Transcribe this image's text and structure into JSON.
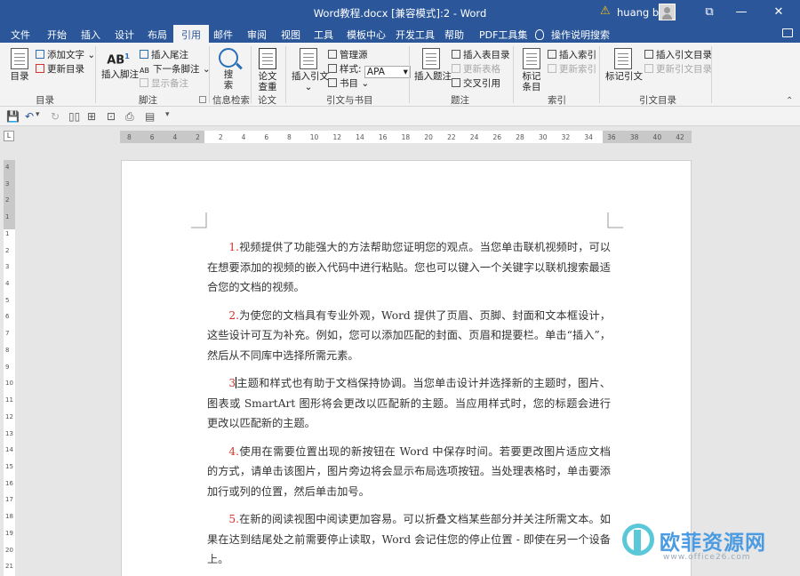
{
  "titlebar": {
    "doc_title": "Word教程.docx [兼容模式]:2  -  Word",
    "warning_icon": "warning-icon",
    "user_name": "huang bo",
    "restore_icon": "ribbon-display-icon",
    "minimize": "—",
    "maximize": "☐",
    "close": "✕"
  },
  "tabs": [
    "文件",
    "开始",
    "插入",
    "设计",
    "布局",
    "引用",
    "邮件",
    "审阅",
    "视图",
    "工具",
    "模板中心",
    "开发工具",
    "帮助",
    "PDF工具集"
  ],
  "active_tab": "引用",
  "tell_me": "操作说明搜索",
  "ribbon": {
    "groups": {
      "toc": {
        "label": "目录",
        "toc_button": "目录",
        "add_text": "添加文字",
        "update_toc": "更新目录"
      },
      "footnotes": {
        "label": "脚注",
        "insert_footnote": "插入脚注",
        "insert_endnote": "插入尾注",
        "next_footnote": "下一条脚注",
        "show_notes": "显示备注"
      },
      "research": {
        "label": "信息检索",
        "search": "搜索"
      },
      "paper": {
        "label": "论文",
        "paper_check": "论文查重"
      },
      "citations": {
        "label": "引文与书目",
        "insert_citation": "插入引文",
        "manage_sources": "管理源",
        "style_label": "样式:",
        "style_value": "APA",
        "bibliography": "书目"
      },
      "captions": {
        "label": "题注",
        "insert_caption": "插入题注",
        "insert_table_of_figures": "插入表目录",
        "update_table": "更新表格",
        "cross_reference": "交叉引用"
      },
      "index": {
        "label": "索引",
        "mark_entry": "标记条目",
        "insert_index": "插入索引",
        "update_index": "更新索引"
      },
      "toa": {
        "label": "引文目录",
        "mark_citation": "标记引文",
        "insert_toa": "插入引文目录",
        "update_toa": "更新引文目录"
      }
    }
  },
  "ruler": {
    "ticks": [
      "8",
      "6",
      "4",
      "2",
      "2",
      "4",
      "6",
      "8",
      "10",
      "12",
      "14",
      "16",
      "18",
      "20",
      "22",
      "24",
      "26",
      "28",
      "30",
      "32",
      "34",
      "36",
      "38",
      "40",
      "42"
    ],
    "vticks": [
      "4",
      "3",
      "2",
      "1",
      "1",
      "2",
      "3",
      "4",
      "5",
      "6",
      "7",
      "8",
      "9",
      "10",
      "11",
      "12",
      "13",
      "14",
      "15",
      "16",
      "17",
      "18",
      "19",
      "20",
      "21"
    ]
  },
  "document": {
    "paragraphs": [
      {
        "num": "1.",
        "text": "视频提供了功能强大的方法帮助您证明您的观点。当您单击联机视频时，可以在想要添加的视频的嵌入代码中进行粘贴。您也可以键入一个关键字以联机搜索最适合您的文档的视频。"
      },
      {
        "num": "2.",
        "text": "为使您的文档具有专业外观，Word 提供了页眉、页脚、封面和文本框设计，这些设计可互为补充。例如，您可以添加匹配的封面、页眉和提要栏。单击“插入”，然后从不同库中选择所需元素。"
      },
      {
        "num": "3",
        "text": "主题和样式也有助于文档保持协调。当您单击设计并选择新的主题时，图片、图表或 SmartArt 图形将会更改以匹配新的主题。当应用样式时，您的标题会进行更改以匹配新的主题。"
      },
      {
        "num": "4.",
        "text": "使用在需要位置出现的新按钮在 Word 中保存时间。若要更改图片适应文档的方式，请单击该图片，图片旁边将会显示布局选项按钮。当处理表格时，单击要添加行或列的位置，然后单击加号。"
      },
      {
        "num": "5.",
        "text": "在新的阅读视图中阅读更加容易。可以折叠文档某些部分并关注所需文本。如果在达到结尾处之前需要停止读取，Word 会记住您的停止位置 - 即使在另一个设备上。"
      }
    ]
  },
  "watermark": {
    "brand": "欧菲资源网",
    "url": "www.office26.com"
  },
  "colors": {
    "title_bar": "#2b579a",
    "ribbon_bg": "#f3f3f3",
    "number_red": "#d8332b"
  }
}
